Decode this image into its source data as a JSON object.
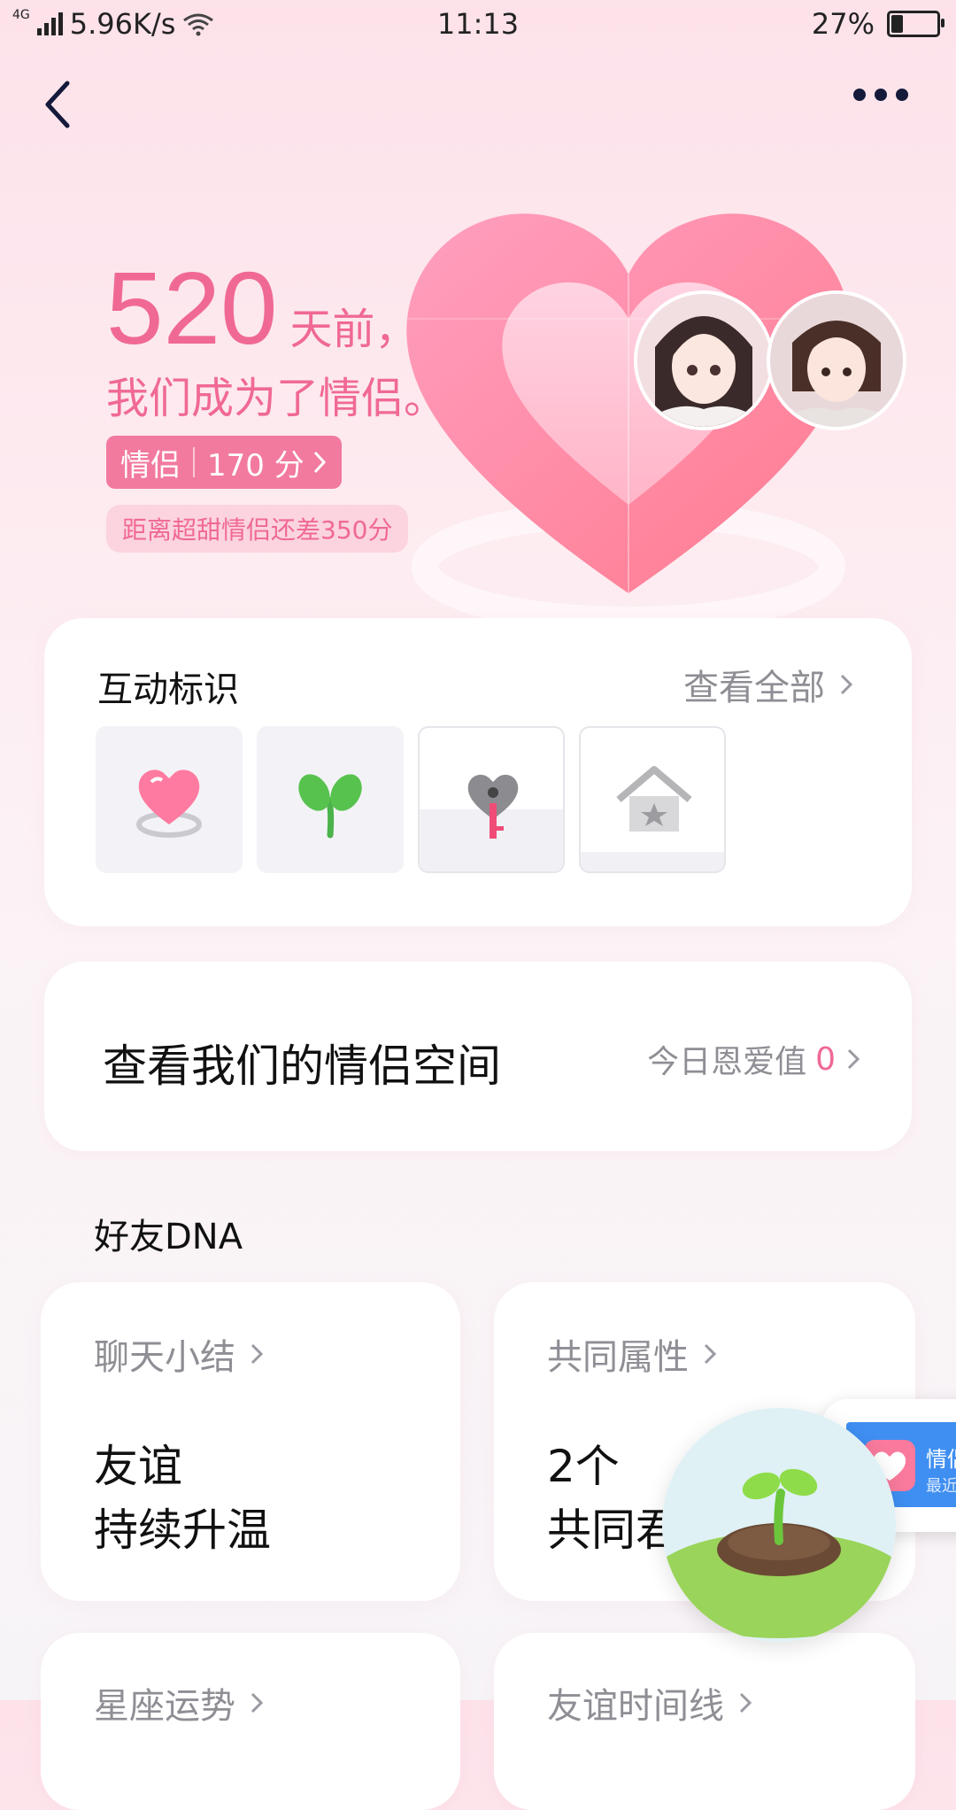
{
  "status_bar": {
    "network_type": "4G",
    "speed": "5.96K/s",
    "time": "11:13",
    "battery_percent": "27%",
    "battery_level": 0.27
  },
  "nav": {
    "back_icon": "chevron-left-icon",
    "more_icon": "more-dots-icon"
  },
  "hero": {
    "days_number": "520",
    "days_suffix": "天前，",
    "subtitle": "我们成为了情侣。",
    "relation_label": "情侣",
    "score": "170 分",
    "gap_text": "距离超甜情侣还差350分"
  },
  "badges_card": {
    "title": "互动标识",
    "link": "查看全部",
    "badges": [
      {
        "icon": "heart-ring-icon"
      },
      {
        "icon": "sprout-icon"
      },
      {
        "icon": "heart-lock-key-icon"
      },
      {
        "icon": "star-house-icon"
      }
    ]
  },
  "space_card": {
    "title": "查看我们的情侣空间",
    "right_label": "今日恩爱值",
    "right_value": "0"
  },
  "dna": {
    "section_title": "好友DNA",
    "cards": [
      {
        "head": "聊天小结",
        "line1": "友谊",
        "line2": "持续升温"
      },
      {
        "head": "共同属性",
        "line1": "2个",
        "line2": "共同君"
      },
      {
        "head": "星座运势"
      },
      {
        "head": "友谊时间线"
      }
    ]
  },
  "floating": {
    "title": "情侣",
    "subtitle": "最近"
  },
  "colors": {
    "accent": "#f06994",
    "pill": "#f27a9e",
    "text_muted": "#8e8e95"
  }
}
